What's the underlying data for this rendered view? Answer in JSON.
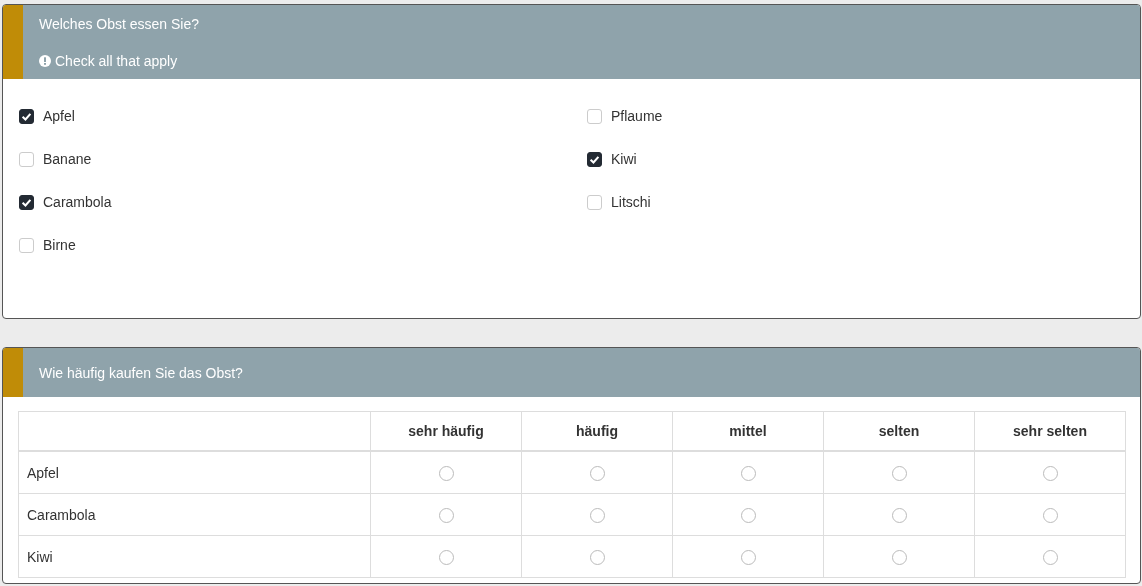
{
  "question_1": {
    "title": "Welches Obst essen Sie?",
    "hint": "Check all that apply",
    "options": [
      {
        "label": "Apfel",
        "checked": true
      },
      {
        "label": "Banane",
        "checked": false
      },
      {
        "label": "Carambola",
        "checked": true
      },
      {
        "label": "Birne",
        "checked": false
      },
      {
        "label": "Pflaume",
        "checked": false
      },
      {
        "label": "Kiwi",
        "checked": true
      },
      {
        "label": "Litschi",
        "checked": false
      }
    ]
  },
  "question_2": {
    "title": "Wie häufig kaufen Sie das Obst?",
    "columns": [
      "sehr häufig",
      "häufig",
      "mittel",
      "selten",
      "sehr selten"
    ],
    "rows": [
      {
        "label": "Apfel",
        "choices": [
          {
            "selected": false
          },
          {
            "selected": false
          },
          {
            "selected": false
          },
          {
            "selected": false
          },
          {
            "selected": false
          }
        ]
      },
      {
        "label": "Carambola",
        "choices": [
          {
            "selected": false
          },
          {
            "selected": false
          },
          {
            "selected": false
          },
          {
            "selected": false
          },
          {
            "selected": false
          }
        ]
      },
      {
        "label": "Kiwi",
        "choices": [
          {
            "selected": false
          },
          {
            "selected": false
          },
          {
            "selected": false
          },
          {
            "selected": false
          },
          {
            "selected": false
          }
        ]
      }
    ]
  }
}
